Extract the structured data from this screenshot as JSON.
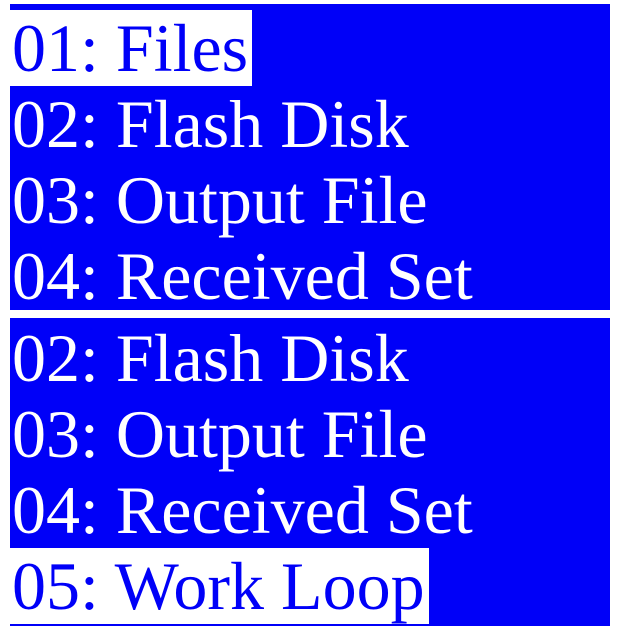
{
  "colors": {
    "background": "#0000f8",
    "text": "#ffffff",
    "selection_background": "#ffffff",
    "selection_text": "#0000f8"
  },
  "panels": [
    {
      "items": [
        {
          "label": "01: Files",
          "selected": true
        },
        {
          "label": "02: Flash Disk",
          "selected": false
        },
        {
          "label": "03: Output File",
          "selected": false
        },
        {
          "label": "04: Received Set",
          "selected": false
        }
      ]
    },
    {
      "items": [
        {
          "label": "02: Flash Disk",
          "selected": false
        },
        {
          "label": "03: Output File",
          "selected": false
        },
        {
          "label": "04: Received Set",
          "selected": false
        },
        {
          "label": "05: Work Loop",
          "selected": true
        }
      ]
    }
  ]
}
